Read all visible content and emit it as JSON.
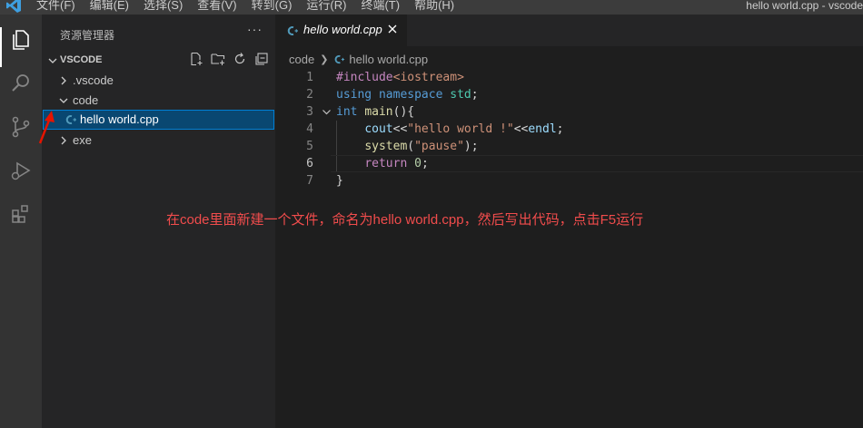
{
  "menubar": {
    "items": [
      "文件(F)",
      "编辑(E)",
      "选择(S)",
      "查看(V)",
      "转到(G)",
      "运行(R)",
      "终端(T)",
      "帮助(H)"
    ],
    "window_title": "hello world.cpp - vscode"
  },
  "activitybar": {
    "icons": [
      "explorer-icon",
      "search-icon",
      "source-control-icon",
      "run-debug-icon",
      "extensions-icon"
    ]
  },
  "sidebar": {
    "title": "资源管理器",
    "more": "···",
    "section": "VSCODE",
    "tree": [
      {
        "label": ".vscode",
        "expanded": false
      },
      {
        "label": "code",
        "expanded": true
      },
      {
        "label": "hello world.cpp",
        "selected": true
      },
      {
        "label": "exe",
        "expanded": false
      }
    ]
  },
  "editor": {
    "tab_label": "hello world.cpp",
    "breadcrumb": [
      "code",
      "hello world.cpp"
    ],
    "current_line": 6,
    "lines": [
      {
        "n": "1"
      },
      {
        "n": "2"
      },
      {
        "n": "3"
      },
      {
        "n": "4"
      },
      {
        "n": "5"
      },
      {
        "n": "6"
      },
      {
        "n": "7"
      }
    ],
    "code": {
      "l1a": "#include",
      "l1b": "<iostream>",
      "l2a": "using",
      "l2b": "namespace",
      "l2c": "std",
      "l2d": ";",
      "l3a": "int",
      "l3b": "main",
      "l3c": "(){",
      "l4a": "cout",
      "l4b": "<<",
      "l4c": "\"hello world !\"",
      "l4d": "<<",
      "l4e": "endl",
      "l4f": ";",
      "l5a": "system",
      "l5b": "(",
      "l5c": "\"pause\"",
      "l5d": ");",
      "l6a": "return",
      "l6b": "0",
      "l6c": ";",
      "l7a": "}"
    }
  },
  "annotation": "在code里面新建一个文件，命名为hello world.cpp，然后写出代码，点击F5运行",
  "colors": {
    "accent": "#007fd4",
    "selection": "#094771",
    "annotation": "#f14c4c",
    "cpp_icon": "#519aba"
  }
}
